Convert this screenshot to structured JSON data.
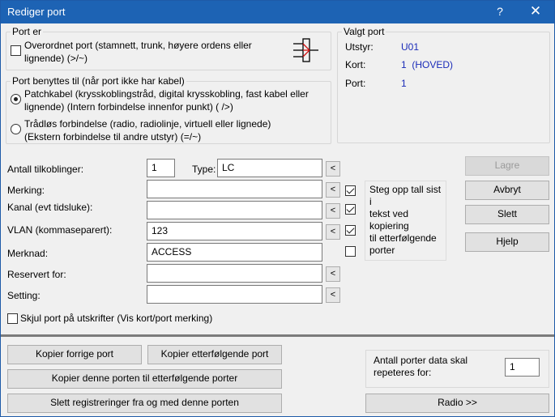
{
  "window": {
    "title": "Rediger port",
    "help_glyph": "?",
    "close_glyph": "✕"
  },
  "port_er": {
    "group_label": "Port er",
    "overordnet_label": "Overordnet port (stamnett, trunk, høyere ordens eller",
    "overordnet_label2": "lignende) (>/~)",
    "overordnet_checked": false,
    "icon": "port-connector-icon"
  },
  "valgt_port": {
    "group_label": "Valgt port",
    "rows": [
      {
        "label": "Utstyr:",
        "value": "U01"
      },
      {
        "label": "Kort:",
        "value": "1  (HOVED)"
      },
      {
        "label": "Port:",
        "value": "1"
      }
    ]
  },
  "benyttes": {
    "group_label": "Port benyttes til (når port ikke har kabel)",
    "patch_line1": "Patchkabel (krysskoblingstråd, digital krysskobling, fast kabel eller",
    "patch_line2": "lignende) (Intern forbindelse innenfor punkt) ( />)",
    "patch_selected": true,
    "tradlos_line1": "Trådløs forbindelse (radio, radiolinje, virtuell eller lignede)",
    "tradlos_line2": "(Ekstern forbindelse til andre utstyr) (=/~)",
    "tradlos_selected": false
  },
  "fields": {
    "antall_label": "Antall tilkoblinger:",
    "antall_value": "1",
    "type_label": "Type:",
    "type_value": "LC",
    "merking_label": "Merking:",
    "merking_value": "",
    "kanal_label": "Kanal (evt tidsluke):",
    "kanal_value": "",
    "vlan_label": "VLAN (kommaseparert):",
    "vlan_value": "123",
    "merknad_label": "Merknad:",
    "merknad_value": "ACCESS",
    "reservert_label": "Reservert for:",
    "reservert_value": "",
    "setting_label": "Setting:",
    "setting_value": "",
    "arrow_glyph": "<"
  },
  "steg": {
    "checks": [
      true,
      true,
      true,
      false
    ],
    "text_lines": [
      "Steg opp tall sist i",
      "tekst ved kopiering",
      "til etterfølgende",
      "porter"
    ]
  },
  "skjul": {
    "label": "Skjul port på utskrifter (Vis kort/port merking)",
    "checked": false
  },
  "buttons": {
    "lagre": "Lagre",
    "avbryt": "Avbryt",
    "slett": "Slett",
    "hjelp": "Hjelp",
    "kopier_forrige": "Kopier forrige port",
    "kopier_etterfolgende": "Kopier etterfølgende port",
    "kopier_denne": "Kopier denne porten til etterfølgende porter",
    "slett_reg": "Slett registreringer fra og med denne porten",
    "radio": "Radio >>"
  },
  "repeat": {
    "label_line1": "Antall porter data skal",
    "label_line2": "repeteres for:",
    "value": "1"
  }
}
